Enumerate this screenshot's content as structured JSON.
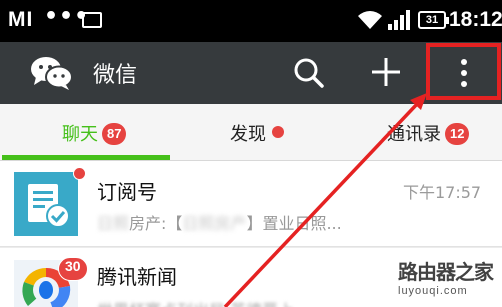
{
  "status_bar": {
    "carrier": "MI",
    "dots": "•••",
    "battery": "31",
    "time": "18:12"
  },
  "action_bar": {
    "title": "微信",
    "icons": [
      "wechat-logo-icon",
      "search-icon",
      "plus-icon",
      "more-vertical-icon"
    ]
  },
  "tabs": [
    {
      "label": "聊天",
      "badge": "87",
      "active": true
    },
    {
      "label": "发现",
      "dot": true
    },
    {
      "label": "通讯录",
      "badge": "12"
    }
  ],
  "chats": [
    {
      "name": "订阅号",
      "time": "下午17:57",
      "preview_blurred_1": "日照",
      "preview_text_1": "房产:【",
      "preview_blurred_2": "日照房产",
      "preview_text_2": "】置业日照..."
    },
    {
      "name": "腾讯新闻",
      "badge": "30",
      "preview": "世界杯赛点刊出局 英德晋上"
    }
  ],
  "watermark": {
    "text": "路由器之家",
    "sub": "luyouqi.com"
  },
  "colors": {
    "accent_green": "#45c01a",
    "badge_red": "#e64340",
    "highlight_red": "#e52222",
    "action_bar": "#363a3d"
  }
}
